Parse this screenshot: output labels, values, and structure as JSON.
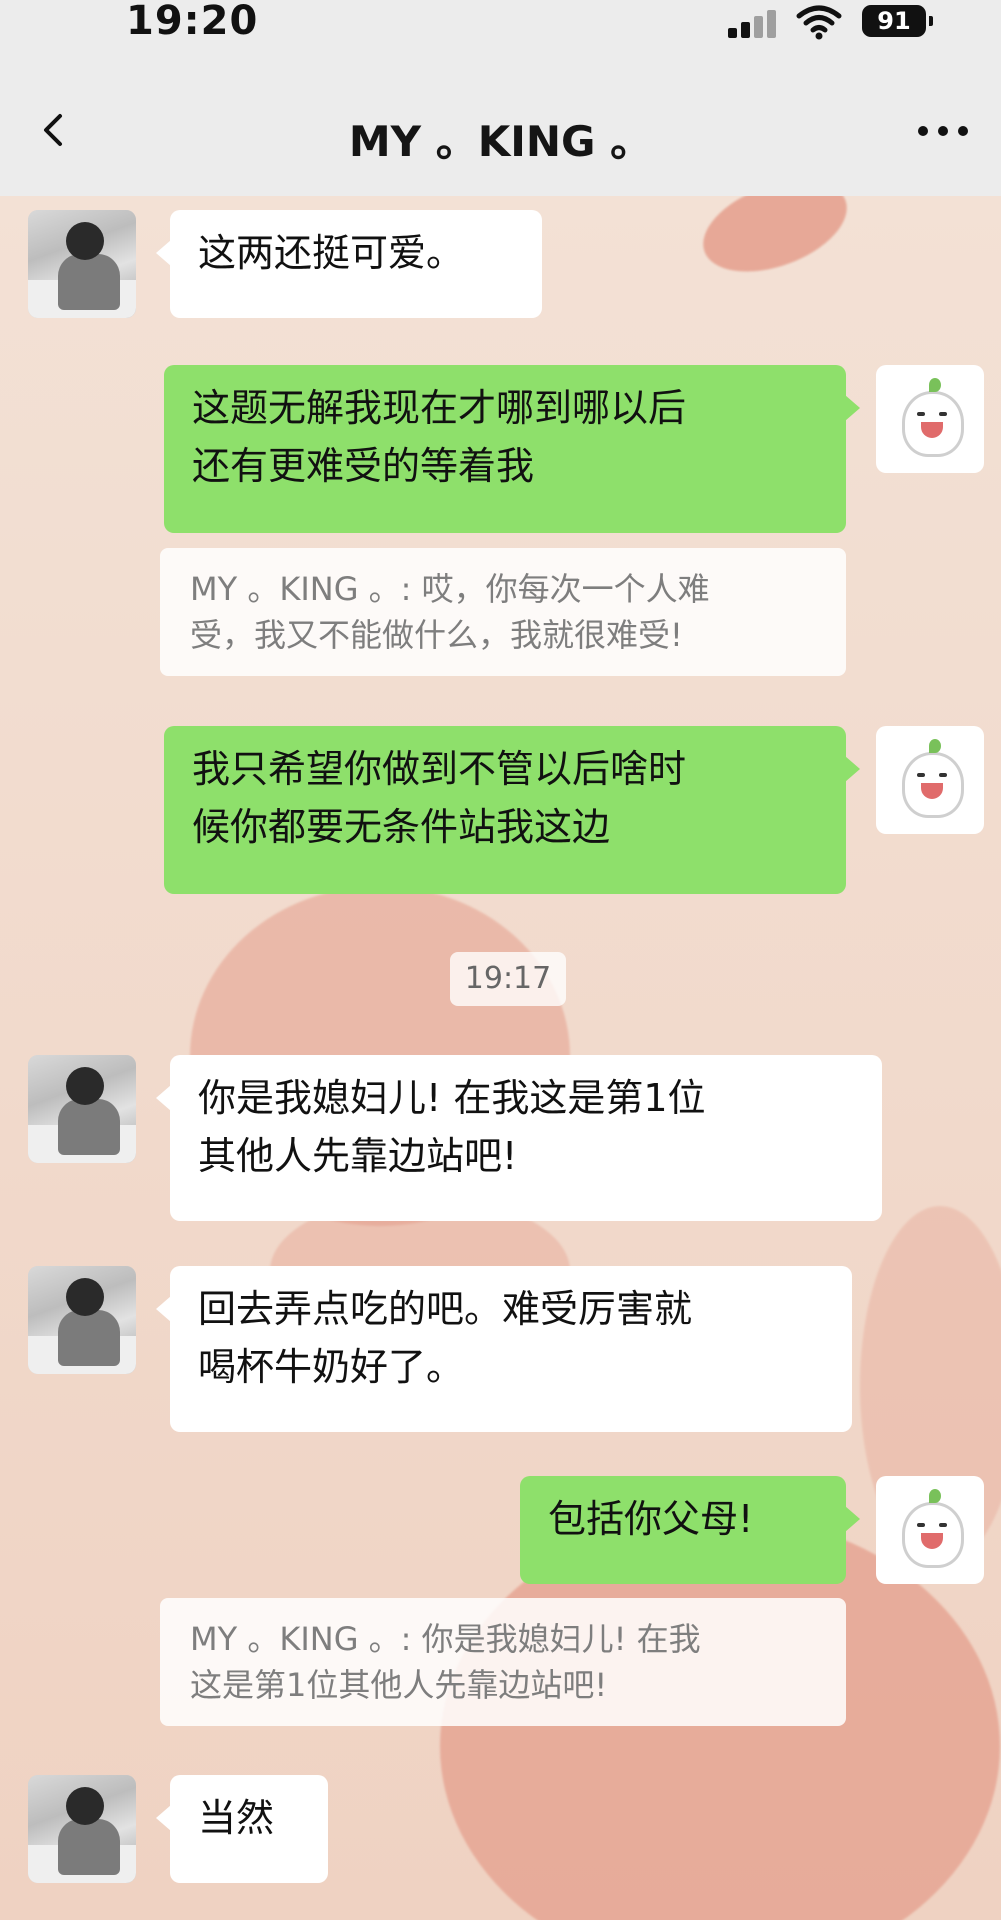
{
  "status_bar": {
    "time": "19:20",
    "battery": "91"
  },
  "header": {
    "title": "MY 。KING 。"
  },
  "messages": {
    "m1": {
      "text": "这两还挺可爱。"
    },
    "m2": {
      "line1": "这题无解我现在才哪到哪以后",
      "line2": "还有更难受的等着我"
    },
    "q1": {
      "line1": "MY 。KING 。: 哎，你每次一个人难",
      "line2": "受，我又不能做什么，我就很难受!"
    },
    "m3": {
      "line1": "我只希望你做到不管以后啥时",
      "line2": "候你都要无条件站我这边"
    },
    "timestamp": "19:17",
    "m4": {
      "line1": "你是我媳妇儿! 在我这是第1位",
      "line2": "其他人先靠边站吧!"
    },
    "m5": {
      "line1": "回去弄点吃的吧。难受厉害就",
      "line2": "喝杯牛奶好了。"
    },
    "m6": {
      "text": "包括你父母!"
    },
    "q2": {
      "line1": "MY 。KING 。: 你是我媳妇儿! 在我",
      "line2": "这是第1位其他人先靠边站吧!"
    },
    "m7": {
      "text": "当然"
    }
  },
  "icons": {
    "back": "chevron-left-icon",
    "more": "more-horizontal-icon",
    "signal": "cellular-signal-icon",
    "wifi": "wifi-icon",
    "battery": "battery-icon"
  },
  "colors": {
    "header_bg": "#ececec",
    "incoming_bubble": "#ffffff",
    "outgoing_bubble": "#8ee06b",
    "chat_bg": "#f2ddd1"
  }
}
